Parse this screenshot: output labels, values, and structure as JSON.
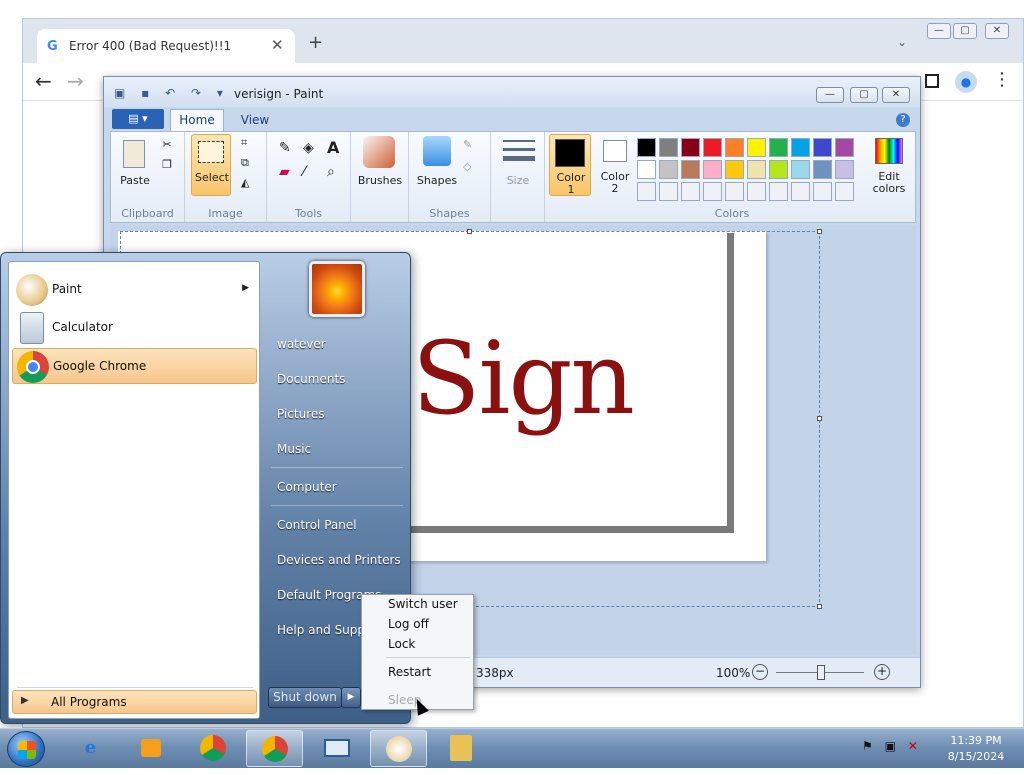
{
  "chrome": {
    "tab_title": "Error 400 (Bad Request)!!1",
    "favicon": "G",
    "new_tab": "+",
    "tab_menu": "⌄",
    "minimize": "—",
    "maximize": "▢",
    "close": "✕",
    "avatar": "●",
    "menu": "⋮"
  },
  "paint": {
    "title": "verisign - Paint",
    "tabs": {
      "home": "Home",
      "view": "View"
    },
    "file_button": "▤ ▾",
    "help": "?",
    "groups": {
      "clipboard": "Clipboard",
      "image": "Image",
      "tools": "Tools",
      "shapes": "Shapes",
      "colors": "Colors"
    },
    "buttons": {
      "paste": "Paste",
      "select": "Select",
      "brushes": "Brushes",
      "shapes": "Shapes",
      "size": "Size",
      "color1": "Color\n1",
      "color1_a": "Color",
      "color1_b": "1",
      "color2_a": "Color",
      "color2_b": "2",
      "edit_colors_a": "Edit",
      "edit_colors_b": "colors"
    },
    "palette_row1": [
      "#000000",
      "#7f7f7f",
      "#880015",
      "#ed1c24",
      "#ff7f27",
      "#fff200",
      "#22b14c",
      "#00a2e8",
      "#3f48cc",
      "#a349a4"
    ],
    "palette_row2": [
      "#ffffff",
      "#c3c3c3",
      "#b97a57",
      "#ffaec9",
      "#ffc90e",
      "#efe4b0",
      "#b5e61d",
      "#99d9ea",
      "#7092be",
      "#c8bfe7"
    ],
    "canvas_text": "Sign",
    "status_dims": "338px",
    "zoom": "100%",
    "zoom_minus": "−",
    "zoom_plus": "+"
  },
  "start_menu": {
    "pinned": [
      {
        "label": "Paint",
        "icon": "paint-icon",
        "has_submenu": true
      },
      {
        "label": "Calculator",
        "icon": "calculator-icon"
      },
      {
        "label": "Google Chrome",
        "icon": "chrome-icon"
      }
    ],
    "submenu_arrow": "▶",
    "all_programs": "All Programs",
    "right": [
      "watever",
      "Documents",
      "Pictures",
      "Music",
      "Computer",
      "Control Panel",
      "Devices and Printers",
      "Default Programs",
      "Help and Support"
    ],
    "shutdown": "Shut down",
    "shutdown_arrow": "▶"
  },
  "shutdown_menu": {
    "items": [
      "Switch user",
      "Log off",
      "Lock",
      "Restart",
      "Sleep"
    ]
  },
  "taskbar": {
    "clock_time": "11:39 PM",
    "clock_date": "8/15/2024",
    "tray_icons": [
      "flag-icon",
      "network-icon",
      "volume-muted-icon"
    ]
  }
}
